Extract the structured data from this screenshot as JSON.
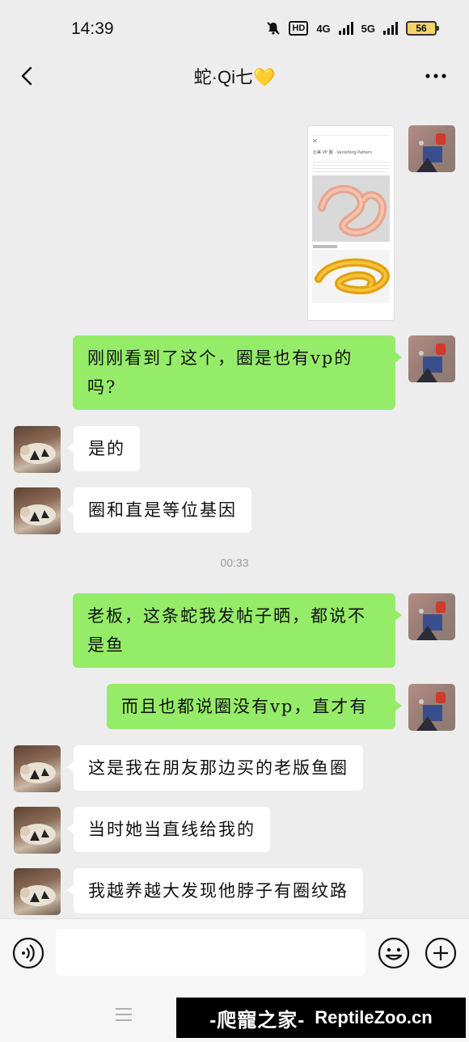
{
  "status_bar": {
    "time": "14:39",
    "hd": "HD",
    "network_4g": "4G",
    "network_5g": "5G",
    "battery": "56"
  },
  "header": {
    "title": "蛇·Qi七💛"
  },
  "messages": [
    {
      "side": "me",
      "type": "image",
      "image_caption": "北美 VP 圈 · Vanishing Pattern"
    },
    {
      "side": "me",
      "text": "刚刚看到了这个，圈是也有vp的吗?"
    },
    {
      "side": "them",
      "text": "是的"
    },
    {
      "side": "them",
      "text": "圈和直是等位基因"
    },
    {
      "side": "me",
      "text": "老板，这条蛇我发帖子晒，都说不是鱼"
    },
    {
      "side": "me",
      "text": "而且也都说圈没有vp，直才有"
    },
    {
      "side": "them",
      "text": "这是我在朋友那边买的老版鱼圈"
    },
    {
      "side": "them",
      "text": "当时她当直线给我的"
    },
    {
      "side": "them",
      "text": "我越养越大发现他脖子有圈纹路"
    }
  ],
  "timestamp": "00:33",
  "watermark": {
    "cn": "-爬寵之家-",
    "en": "ReptileZoo.cn"
  },
  "icons": [
    "back-icon",
    "more-icon",
    "voice-icon",
    "emoji-icon",
    "plus-icon",
    "menu-icon"
  ]
}
